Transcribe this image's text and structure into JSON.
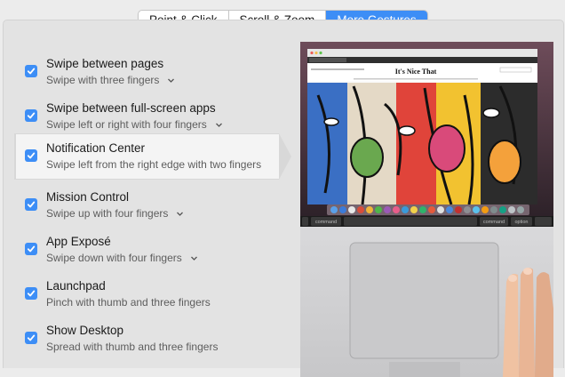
{
  "tabs": [
    {
      "label": "Point & Click",
      "active": false
    },
    {
      "label": "Scroll & Zoom",
      "active": false
    },
    {
      "label": "More Gestures",
      "active": true
    }
  ],
  "gestures": [
    {
      "title": "Swipe between pages",
      "subtitle": "Swipe with three fingers",
      "checked": true,
      "has_menu": true
    },
    {
      "title": "Swipe between full-screen apps",
      "subtitle": "Swipe left or right with four fingers",
      "checked": true,
      "has_menu": true
    },
    {
      "title": "Notification Center",
      "subtitle": "Swipe left from the right edge with two fingers",
      "checked": true,
      "has_menu": false
    },
    {
      "title": "Mission Control",
      "subtitle": "Swipe up with four fingers",
      "checked": true,
      "has_menu": true
    },
    {
      "title": "App Exposé",
      "subtitle": "Swipe down with four fingers",
      "checked": true,
      "has_menu": true
    },
    {
      "title": "Launchpad",
      "subtitle": "Pinch with thumb and three fingers",
      "checked": true,
      "has_menu": false
    },
    {
      "title": "Show Desktop",
      "subtitle": "Spread with thumb and three fingers",
      "checked": true,
      "has_menu": false
    }
  ],
  "preview": {
    "site_title": "It's Nice That",
    "keys": [
      "command",
      "command",
      "option"
    ]
  },
  "colors": {
    "accent": "#3d8ef6"
  }
}
